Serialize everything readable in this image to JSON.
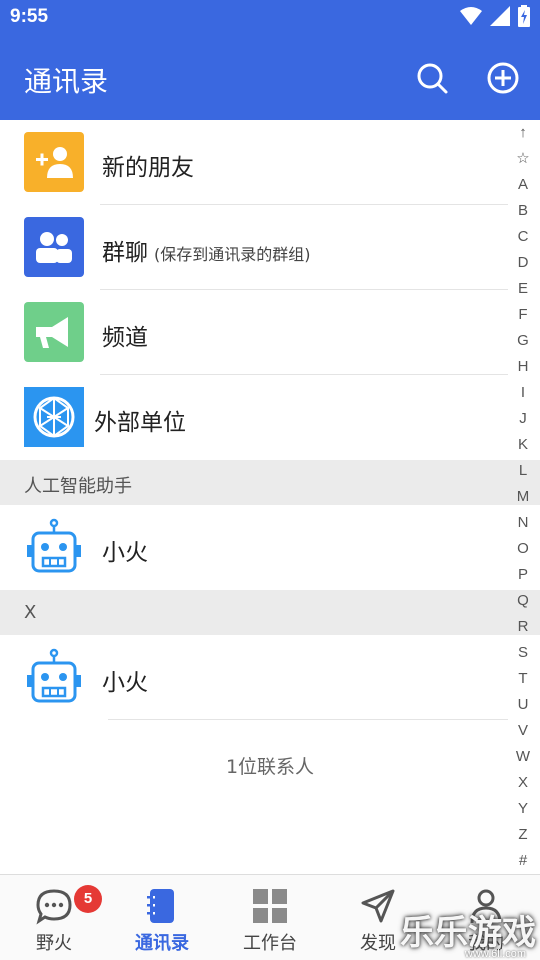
{
  "status_bar": {
    "time": "9:55",
    "icons": [
      "wifi-icon",
      "signal-icon",
      "battery-icon"
    ]
  },
  "header": {
    "title": "通讯录",
    "actions": [
      "search-icon",
      "add-icon"
    ]
  },
  "colors": {
    "brand": "#3a68e0",
    "new_friend": "#f8b02a",
    "group": "#3a68e0",
    "channel": "#6fcf8a",
    "org": "#2b95f0",
    "badge": "#e53935"
  },
  "menu": [
    {
      "label": "新的朋友",
      "sub": "",
      "icon": "add-friend-icon"
    },
    {
      "label": "群聊",
      "sub": "(保存到通讯录的群组)",
      "icon": "group-icon"
    },
    {
      "label": "频道",
      "sub": "",
      "icon": "megaphone-icon"
    },
    {
      "label": "外部单位",
      "sub": "",
      "icon": "network-globe-icon"
    }
  ],
  "sections": [
    {
      "title": "人工智能助手",
      "contacts": [
        {
          "name": "小火",
          "icon": "robot-icon"
        }
      ]
    },
    {
      "title": "X",
      "contacts": [
        {
          "name": "小火",
          "icon": "robot-icon"
        }
      ]
    }
  ],
  "contact_count": "1位联系人",
  "index_letters": [
    "↑",
    "☆",
    "A",
    "B",
    "C",
    "D",
    "E",
    "F",
    "G",
    "H",
    "I",
    "J",
    "K",
    "L",
    "M",
    "N",
    "O",
    "P",
    "Q",
    "R",
    "S",
    "T",
    "U",
    "V",
    "W",
    "X",
    "Y",
    "Z",
    "#"
  ],
  "tabs": [
    {
      "label": "野火",
      "icon": "chat-bubble-icon",
      "badge": "5",
      "active": false
    },
    {
      "label": "通讯录",
      "icon": "contacts-book-icon",
      "badge": "",
      "active": true
    },
    {
      "label": "工作台",
      "icon": "workbench-grid-icon",
      "badge": "",
      "active": false
    },
    {
      "label": "发现",
      "icon": "discover-send-icon",
      "badge": "",
      "active": false
    },
    {
      "label": "我的",
      "icon": "profile-icon",
      "badge": "",
      "active": false
    }
  ],
  "watermark": {
    "main": "乐乐游戏",
    "sub": "www.6ll.com"
  }
}
